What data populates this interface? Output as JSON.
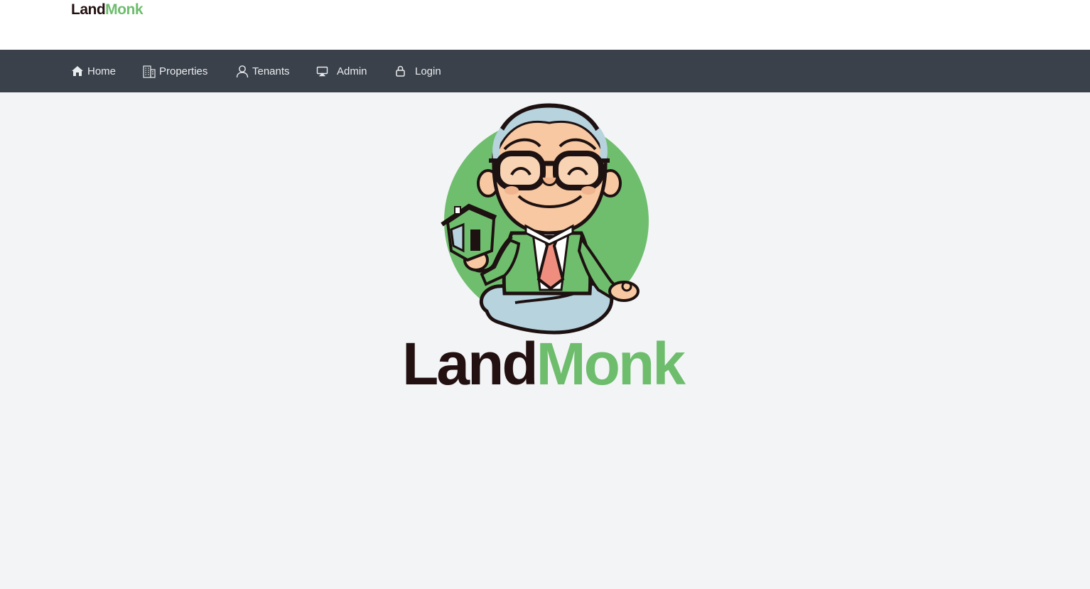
{
  "brand": {
    "part1": "Land",
    "part2": "Monk"
  },
  "nav": {
    "items": [
      {
        "label": "Home",
        "icon": "home-icon"
      },
      {
        "label": "Properties",
        "icon": "building-icon"
      },
      {
        "label": "Tenants",
        "icon": "user-icon"
      },
      {
        "label": "Admin",
        "icon": "monitor-icon"
      },
      {
        "label": "Login",
        "icon": "lock-icon"
      }
    ]
  },
  "hero": {
    "logo_part1": "Land",
    "logo_part2": "Monk"
  },
  "colors": {
    "navbar": "#3a414a",
    "brand_dark": "#231010",
    "brand_green": "#6dbd6d",
    "page_bg": "#f3f4f6"
  }
}
